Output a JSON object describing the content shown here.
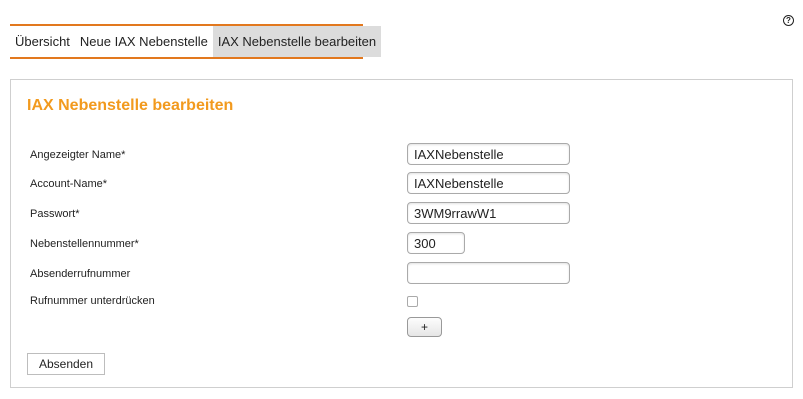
{
  "help": {
    "icon": "question-circle-icon",
    "symbol": "?"
  },
  "tabs": [
    {
      "label": "Übersicht",
      "active": false
    },
    {
      "label": "Neue IAX Nebenstelle",
      "active": false
    },
    {
      "label": "IAX Nebenstelle bearbeiten",
      "active": true
    }
  ],
  "form": {
    "title": "IAX Nebenstelle bearbeiten",
    "fields": {
      "display_name": {
        "label": "Angezeigter Name*",
        "value": "IAXNebenstelle"
      },
      "account_name": {
        "label": "Account-Name*",
        "value": "IAXNebenstelle"
      },
      "password": {
        "label": "Passwort*",
        "value": "3WM9rrawW1"
      },
      "extension_number": {
        "label": "Nebenstellennummer*",
        "value": "300"
      },
      "caller_number": {
        "label": "Absenderrufnummer",
        "value": ""
      },
      "suppress_number": {
        "label": "Rufnummer unterdrücken",
        "checked": false
      }
    },
    "plus_label": "+",
    "submit_label": "Absenden"
  },
  "colors": {
    "accent": "#e2781e",
    "title": "#f29a1e",
    "active_tab": "#dcdcdc"
  }
}
